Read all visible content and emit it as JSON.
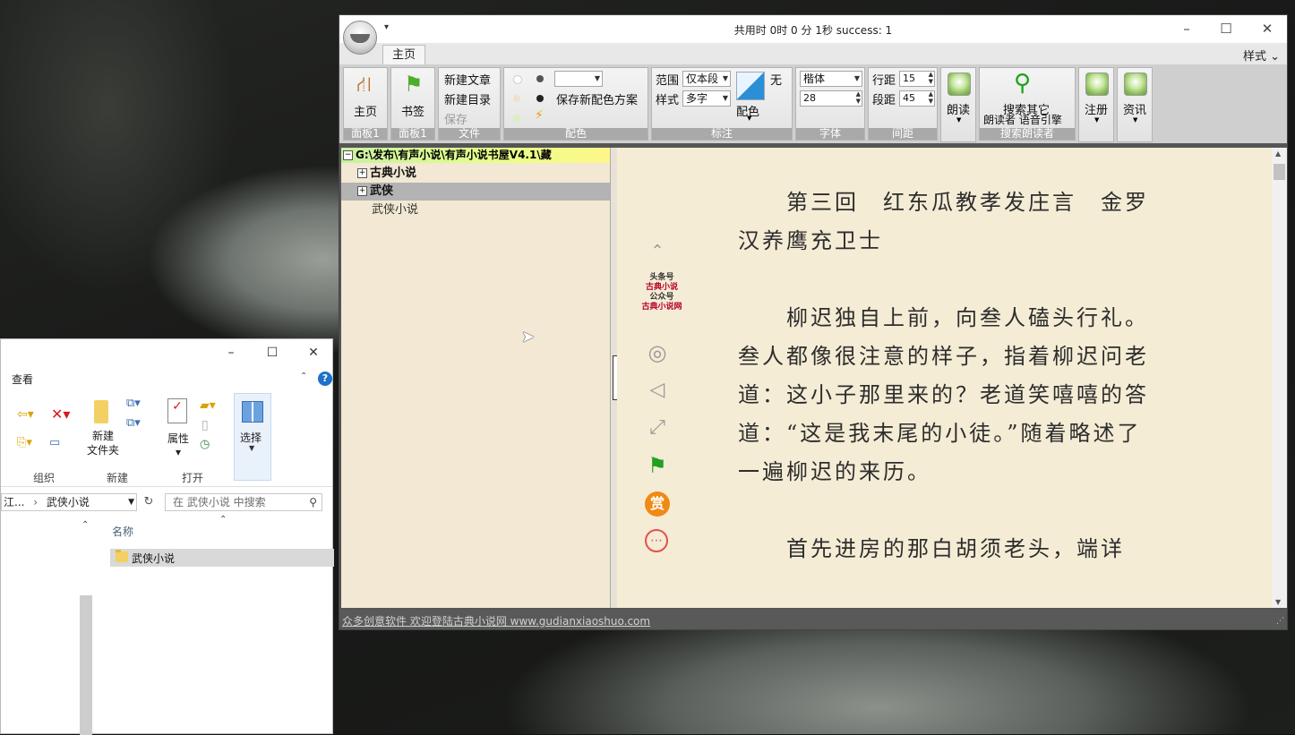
{
  "explorer": {
    "tab_view": "查看",
    "groups": [
      "组织",
      "新建",
      "打开"
    ],
    "new_folder_label": "新建\n文件夹",
    "properties_label": "属性",
    "select_label": "选择",
    "address_prefix": "江...",
    "address_current": "武侠小说",
    "search_placeholder": "在 武侠小说 中搜索",
    "column_name": "名称",
    "files": [
      {
        "name": "武侠小说"
      }
    ]
  },
  "app": {
    "title": "共用时 0时  0 分 1秒   success: 1",
    "tab_main": "主页",
    "style_menu": "样式 ⌄",
    "ribbon": {
      "home_btn": "主页",
      "panel1": "面板1",
      "bookmark_btn": "书签",
      "panel1b": "面板1",
      "new_article": "新建文章",
      "new_dir": "新建目录",
      "save": "保存",
      "file_group": "文件",
      "save_scheme": "保存新配色方案",
      "color_group": "配色",
      "range_label": "范围",
      "range_value": "仅本段",
      "style_label": "样式",
      "style_value": "多字",
      "none_label": "无",
      "color_btn": "配色",
      "mark_group": "标注",
      "font_value": "楷体",
      "font_size": "28",
      "font_group": "字体",
      "line_spacing_label": "行距",
      "line_spacing": "15",
      "para_spacing_label": "段距",
      "para_spacing": "45",
      "spacing_group": "间距",
      "read_btn": "朗读",
      "search_other": "搜索其它",
      "search_sub": "朗读者 语音引擎",
      "search_group": "搜索朗读者",
      "register_btn": "注册",
      "news_btn": "资讯"
    },
    "tree": {
      "root": "G:\\发布\\有声小说\\有声小说书屋V4.1\\藏",
      "items": [
        {
          "label": "古典小说",
          "bold": true
        },
        {
          "label": "武侠",
          "bold": true
        },
        {
          "label": "武侠小说",
          "bold": false
        }
      ]
    },
    "reader": {
      "paragraphs": [
        "　　第三回　红东瓜教孝发庄言　金罗汉养鹰充卫士",
        "　　柳迟独自上前，向叁人磕头行礼。叁人都像很注意的样子，指着柳迟问老道：这小子那里来的？老道笑嘻嘻的答道：“这是我末尾的小徒。”随着略述了一遍柳迟的来历。",
        "　　首先进房的那白胡须老头，端详"
      ],
      "promo_line1": "头条号",
      "promo_line2": "古典小说",
      "promo_line3": "公众号",
      "promo_line4": "古典小说网",
      "reward_icon_text": "赏"
    },
    "status": "众多创意软件 欢迎登陆古典小说网  www.gudianxiaoshuo.com",
    "colors": {
      "accent_orange": "#f08a16",
      "reader_bg": "#f5ecd5",
      "tree_bg": "#f2e8d3"
    }
  }
}
